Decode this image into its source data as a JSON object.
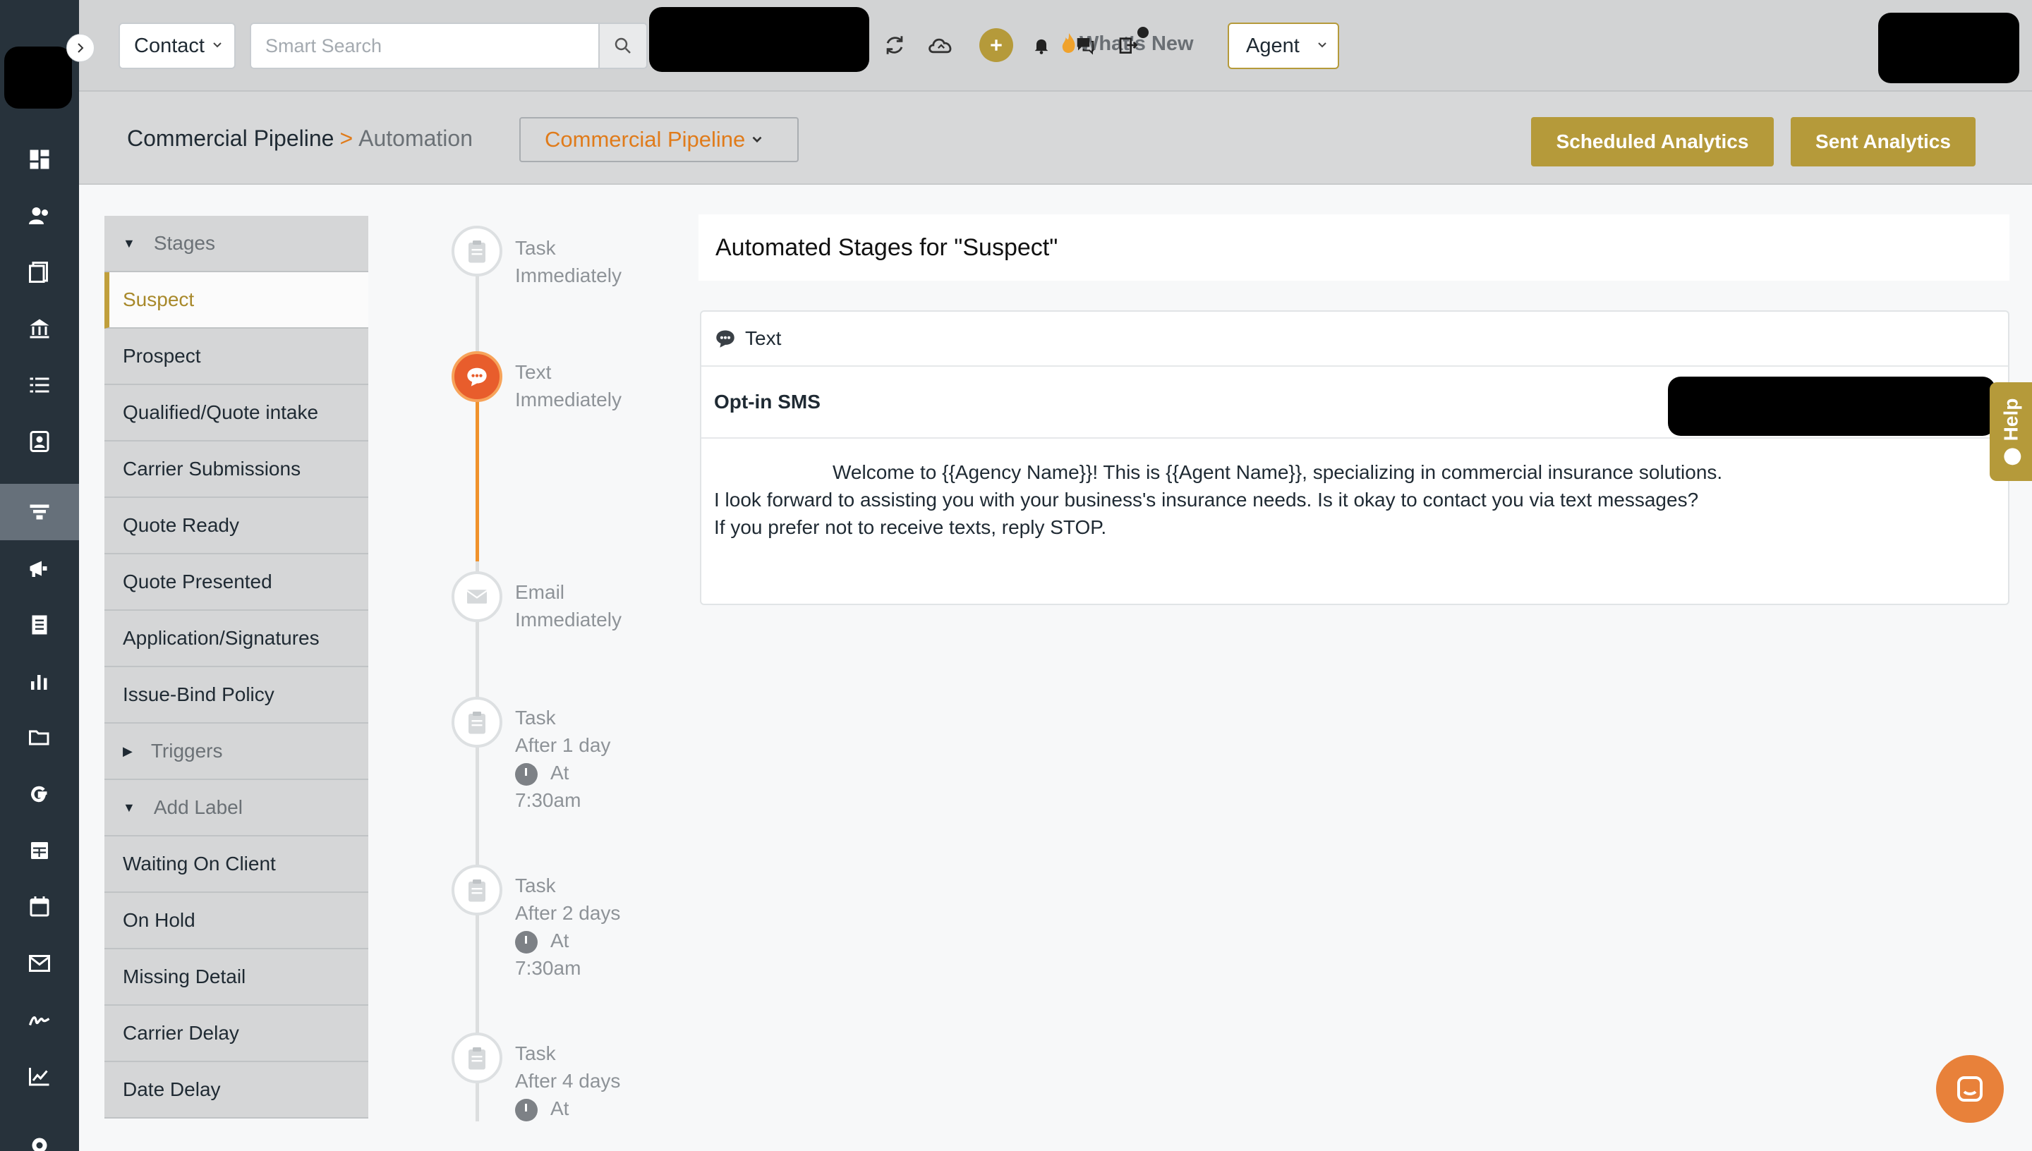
{
  "topbar": {
    "contact_select": "Contact",
    "search_placeholder": "Smart Search",
    "whats_new": "What's New",
    "agent_select": "Agent"
  },
  "header": {
    "breadcrumb_root": "Commercial Pipeline",
    "breadcrumb_sep": ">",
    "breadcrumb_current": "Automation",
    "pipeline_select": "Commercial Pipeline",
    "scheduled_analytics": "Scheduled Analytics",
    "sent_analytics": "Sent Analytics"
  },
  "sidebar": {
    "stages_heading": "Stages",
    "stages": [
      "Suspect",
      "Prospect",
      "Qualified/Quote intake",
      "Carrier Submissions",
      "Quote Ready",
      "Quote Presented",
      "Application/Signatures",
      "Issue-Bind Policy"
    ],
    "triggers_heading": "Triggers",
    "label_heading": "Add Label",
    "labels": [
      "Waiting On Client",
      "On Hold",
      "Missing Detail",
      "Carrier Delay",
      "Date Delay"
    ]
  },
  "timeline": [
    {
      "type": "Task",
      "timing": "Immediately",
      "icon": "clipboard-icon"
    },
    {
      "type": "Text",
      "timing": "Immediately",
      "icon": "chat-bubble-icon",
      "active": true
    },
    {
      "type": "Email",
      "timing": "Immediately",
      "icon": "envelope-icon"
    },
    {
      "type": "Task",
      "timing": "After 1 day",
      "at": "At",
      "time": "7:30am",
      "icon": "clipboard-icon"
    },
    {
      "type": "Task",
      "timing": "After 2 days",
      "at": "At",
      "time": "7:30am",
      "icon": "clipboard-icon"
    },
    {
      "type": "Task",
      "timing": "After 4 days",
      "at": "At",
      "icon": "clipboard-icon"
    }
  ],
  "main": {
    "stage_title": "Automated Stages for \"Suspect\"",
    "action_type": "Text",
    "action_name": "Opt-in SMS",
    "message_line1": "Welcome to {{Agency Name}}! This is {{Agent Name}}, specializing in commercial insurance solutions.",
    "message_line2": "I look forward to assisting you with your business's insurance needs. Is it okay to contact you via text messages?",
    "message_line3": "If you prefer not to receive texts, reply STOP."
  },
  "help_tab": "Help",
  "colors": {
    "rail": "#27323b",
    "gold": "#b59a3a",
    "orange": "#e07b1a",
    "active_node": "#e85d2c"
  }
}
